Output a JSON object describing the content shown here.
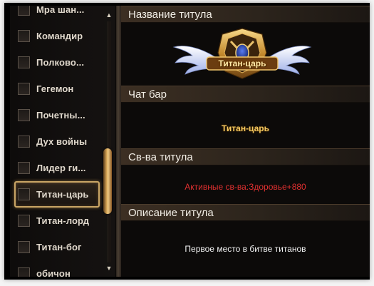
{
  "list": {
    "items": [
      {
        "label": "Мра шан..."
      },
      {
        "label": "Командир"
      },
      {
        "label": "Полково..."
      },
      {
        "label": "Гегемон"
      },
      {
        "label": "Почетны..."
      },
      {
        "label": "Дух войны"
      },
      {
        "label": "Лидер ги..."
      },
      {
        "label": "Титан-царь",
        "selected": true
      },
      {
        "label": "Титан-лорд"
      },
      {
        "label": "Титан-бог"
      },
      {
        "label": "обичон"
      }
    ],
    "scroll_up_icon": "triangle-up",
    "scroll_down_icon": "triangle-down"
  },
  "sections": {
    "name_header": "Название титула",
    "chat_header": "Чат бар",
    "attr_header": "Св-ва титула",
    "desc_header": "Описание титула"
  },
  "emblem": {
    "title": "Титан-царь",
    "icon": "winged-crest-icon"
  },
  "chat": {
    "title": "Титан-царь"
  },
  "attributes": {
    "text": "Активные св-ва:Здоровье+880"
  },
  "description": {
    "text": "Первое место в битве титанов"
  },
  "colors": {
    "header_bg": "#3c2f23",
    "selected_border": "#c9a565",
    "attr_text": "#e03030",
    "chat_title": "#f4c860"
  }
}
